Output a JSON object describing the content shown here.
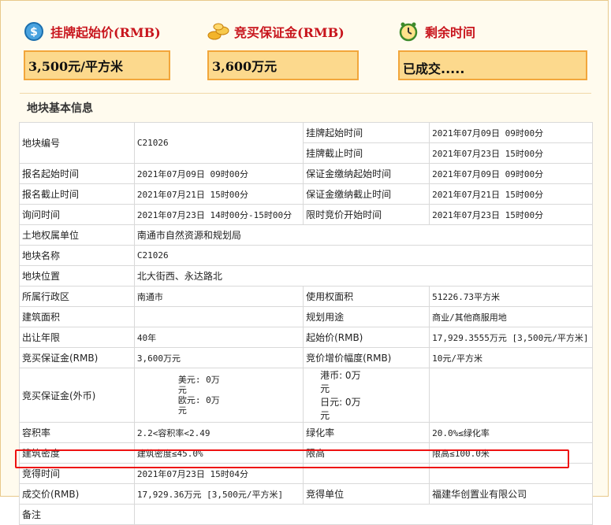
{
  "summary": {
    "start_price": {
      "label": "挂牌起始价(RMB)",
      "value": "3,500元/平方米"
    },
    "deposit": {
      "label": "竞买保证金(RMB)",
      "value": "3,600万元"
    },
    "remaining": {
      "label": "剩余时间",
      "value": "已成交....."
    }
  },
  "section_title": "地块基本信息",
  "rows": [
    {
      "l": "地块编号",
      "v": "C21026",
      "l2a": "挂牌起始时间",
      "v2a": "2021年07月09日 09时00分",
      "l2b": "挂牌截止时间",
      "v2b": "2021年07月23日 15时00分"
    },
    {
      "l": "报名起始时间",
      "v": "2021年07月09日 09时00分",
      "l2": "保证金缴纳起始时间",
      "v2": "2021年07月09日 09时00分"
    },
    {
      "l": "报名截止时间",
      "v": "2021年07月21日 15时00分",
      "l2": "保证金缴纳截止时间",
      "v2": "2021年07月21日 15时00分"
    },
    {
      "l": "询问时间",
      "v": "2021年07月23日 14时00分-15时00分",
      "l2": "限时竞价开始时间",
      "v2": "2021年07月23日 15时00分"
    },
    {
      "l": "土地权属单位",
      "v": "南通市自然资源和规划局"
    },
    {
      "l": "地块名称",
      "v": "C21026"
    },
    {
      "l": "地块位置",
      "v": "北大街西、永达路北"
    },
    {
      "l": "所属行政区",
      "v": "南通市",
      "l2": "使用权面积",
      "v2": "51226.73平方米"
    },
    {
      "l": "建筑面积",
      "v": "",
      "l2": "规划用途",
      "v2": "商业/其他商服用地"
    },
    {
      "l": "出让年限",
      "v": "40年",
      "l2": "起始价(RMB)",
      "v2": "17,929.3555万元 [3,500元/平方米]"
    },
    {
      "l": "竞买保证金(RMB)",
      "v": "3,600万元",
      "l2": "竞价增价幅度(RMB)",
      "v2": "10元/平方米"
    },
    {
      "l": "竞买保证金(外币)",
      "fx": {
        "usd": "美元: 0万元",
        "eur": "欧元: 0万元",
        "hkd": "港币: 0万元",
        "jpy": "日元: 0万元"
      }
    },
    {
      "l": "容积率",
      "v": "2.2<容积率<2.49",
      "l2": "绿化率",
      "v2": "20.0%≤绿化率"
    },
    {
      "l": "建筑密度",
      "v": "建筑密度≤45.0%",
      "l2": "限高",
      "v2": "限高≤100.0米"
    },
    {
      "l": "竞得时间",
      "v": "2021年07月23日 15时04分",
      "l2": "",
      "v2": ""
    },
    {
      "l": "成交价(RMB)",
      "v": "17,929.36万元 [3,500元/平方米]",
      "l2": "竞得单位",
      "v2": "福建华创置业有限公司"
    },
    {
      "l": "备注",
      "v": ""
    }
  ],
  "colors": {
    "accent_red": "#c8151d",
    "box_fill": "#fcd98d",
    "box_border": "#f2a63b",
    "highlight": "#e11111"
  }
}
